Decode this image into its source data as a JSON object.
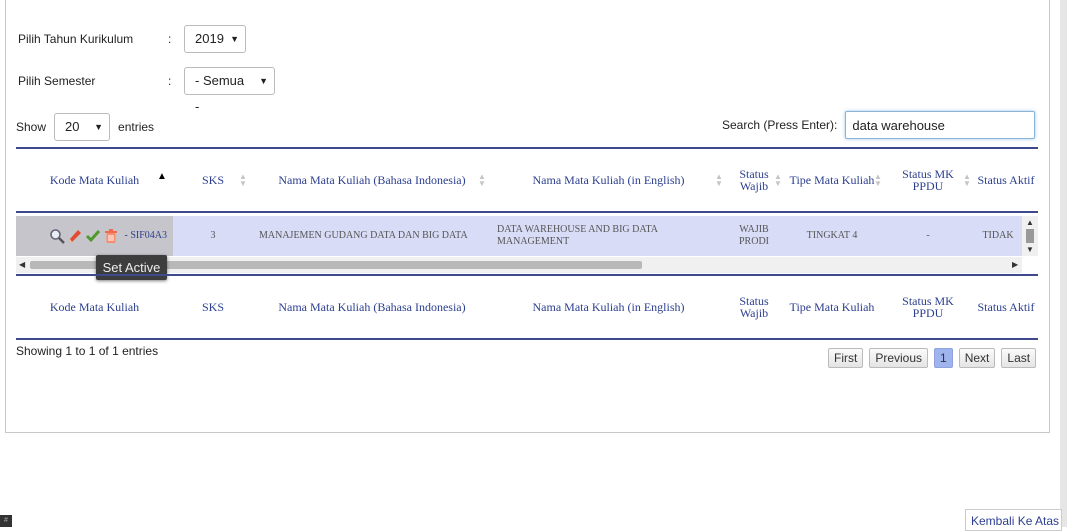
{
  "filters": {
    "tahun_label": "Pilih Tahun Kurikulum",
    "tahun_value": "2019",
    "semester_label": "Pilih Semester",
    "semester_value": "- Semua -",
    "colon": ":",
    "caret": "▼"
  },
  "length": {
    "show": "Show",
    "value": "20",
    "entries": "entries"
  },
  "search": {
    "label": "Search (Press Enter):",
    "value": "data warehouse"
  },
  "columns": [
    "Kode Mata Kuliah",
    "SKS",
    "Nama Mata Kuliah (Bahasa Indonesia)",
    "Nama Mata Kuliah (in English)",
    "Status Wajib",
    "Tipe Mata Kuliah",
    "Status MK PPDU",
    "Status Aktif"
  ],
  "header_sort_active_glyph": "▲",
  "row": {
    "code": "- SIF04A3",
    "sks": "3",
    "nama_id": "MANAJEMEN GUDANG DATA DAN BIG DATA",
    "nama_en": "DATA WAREHOUSE AND BIG DATA MANAGEMENT",
    "status_wajib": "WAJIB PRODI",
    "tipe": "TINGKAT 4",
    "ppdu": "-",
    "aktif": "TIDAK"
  },
  "tooltip": "Set Active",
  "info": "Showing 1 to 1 of 1 entries",
  "pagination": {
    "first": "First",
    "previous": "Previous",
    "current": "1",
    "next": "Next",
    "last": "Last"
  },
  "back_to_top": "Kembali Ke Atas",
  "colors": {
    "header_text": "#2c3f8f",
    "row_bg": "#d9dcf7",
    "rule": "#3f4a8c",
    "current_page": "#9fb3ee"
  },
  "icons": [
    "search-icon",
    "pencil-icon",
    "checkmark-icon",
    "trash-icon"
  ]
}
